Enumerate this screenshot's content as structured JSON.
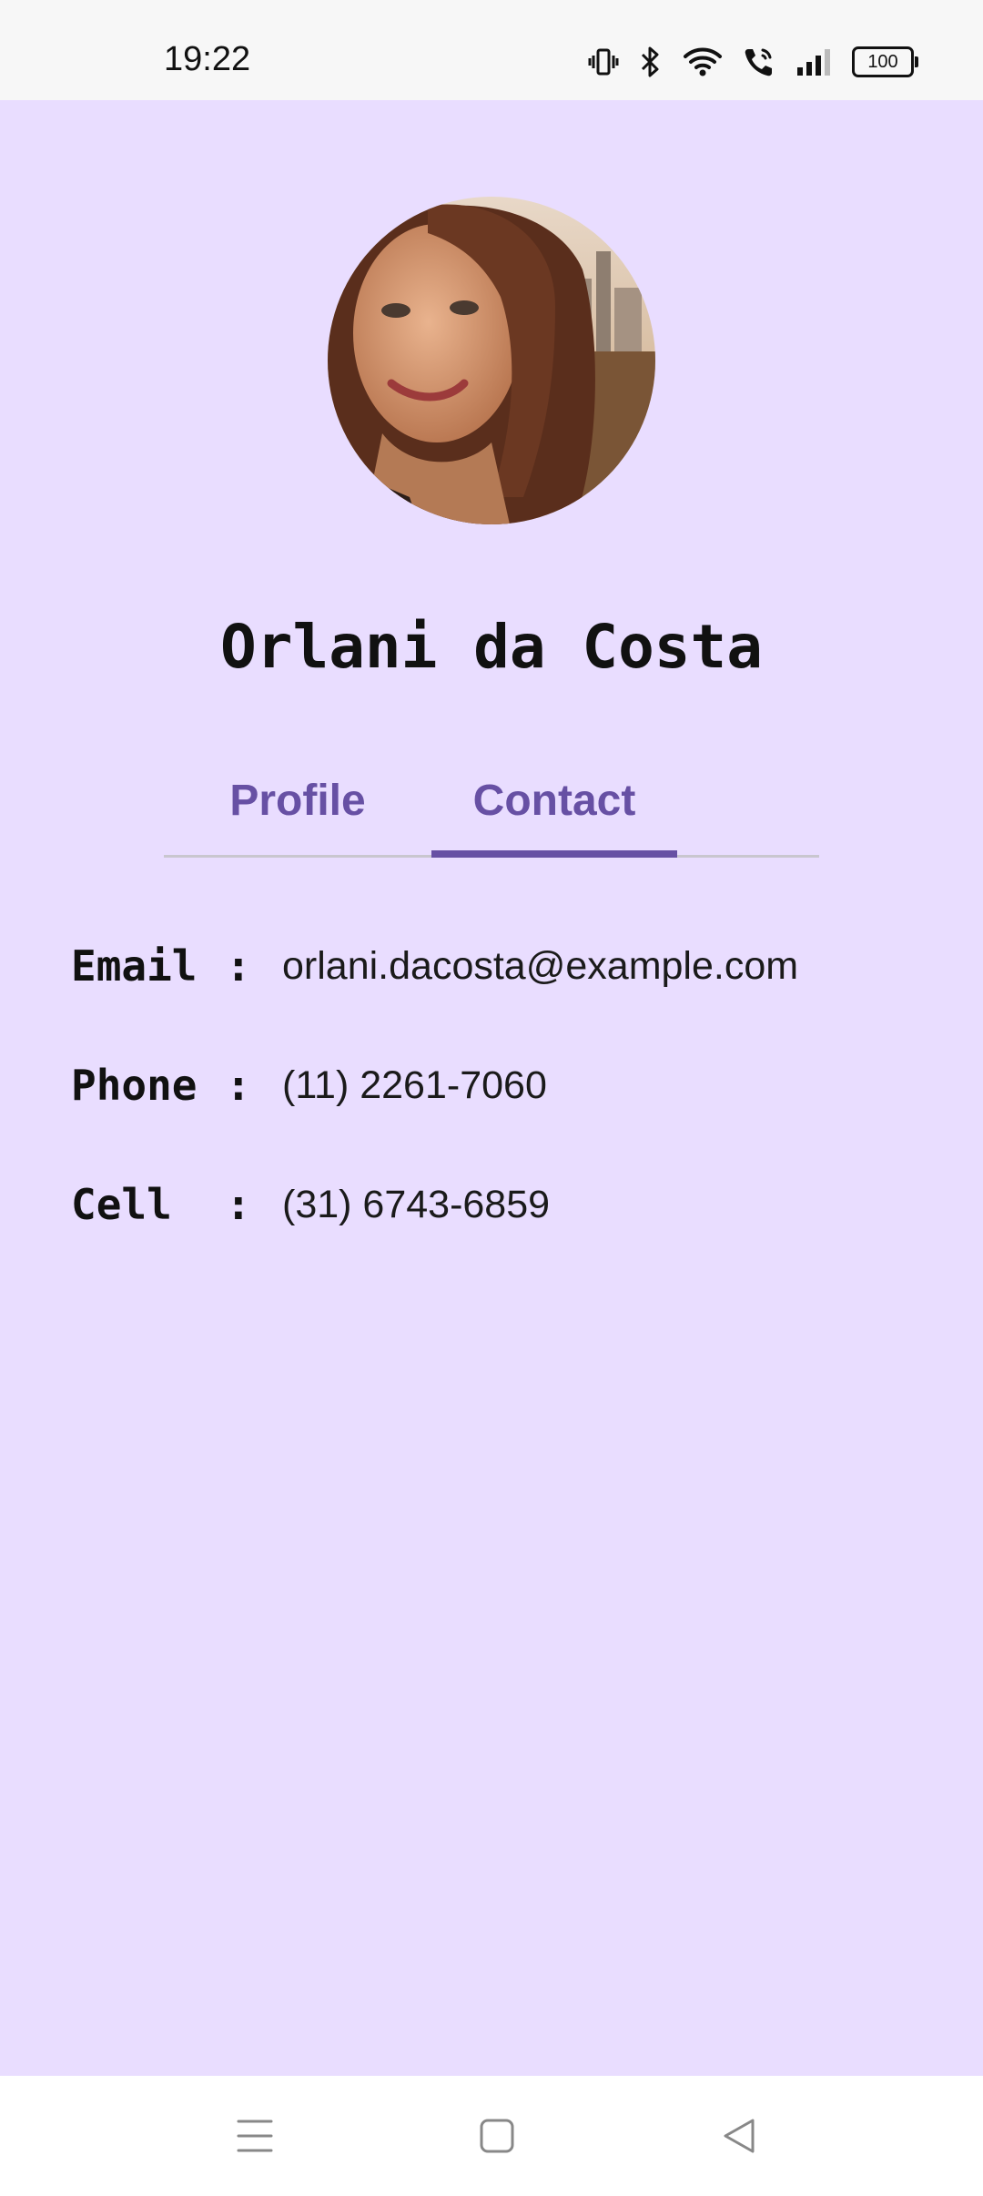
{
  "status_bar": {
    "time": "19:22",
    "icons": [
      "vibrate-icon",
      "bluetooth-icon",
      "wifi-icon",
      "wifi-call-icon",
      "signal-icon",
      "battery-icon"
    ],
    "battery_level": "100"
  },
  "profile": {
    "name": "Orlani da Costa",
    "avatar_alt": "profile photo"
  },
  "tabs": [
    {
      "label": "Profile",
      "selected": false
    },
    {
      "label": "Contact",
      "selected": true
    }
  ],
  "contact": {
    "email": {
      "label": "Email",
      "separator": ":",
      "value": "orlani.dacosta@example.com"
    },
    "phone": {
      "label": "Phone",
      "separator": ":",
      "value": "(11) 2261-7060"
    },
    "cell": {
      "label": "Cell",
      "separator": ":",
      "value": "(31) 6743-6859"
    }
  },
  "nav_bar": {
    "icons": [
      "menu-icon",
      "home-icon",
      "back-icon"
    ]
  },
  "colors": {
    "background": "#E9DDFF",
    "accent": "#6750A4",
    "status_bar": "#F7F7F7",
    "nav_bar": "#FFFFFF"
  }
}
